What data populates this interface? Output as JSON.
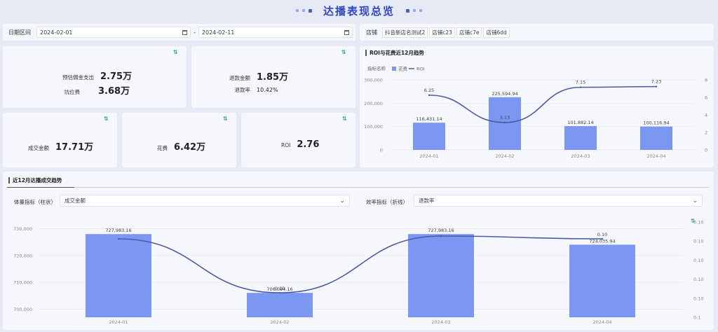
{
  "header": {
    "title": "达播表现总览"
  },
  "filters": {
    "date_label": "日期区间",
    "date_start": "2024-02-01",
    "date_sep": "-",
    "date_end": "2024-02-11",
    "store_label": "店铺",
    "stores": [
      "抖音新店名测试2",
      "店铺c23",
      "店铺c7e",
      "店铺6dd"
    ]
  },
  "kpi_icon": "⇅",
  "kpis": {
    "commission_label": "预估佣金支出",
    "commission_value": "2.75万",
    "slot_fee_label": "坑位费",
    "slot_fee_value": "3.68万",
    "refund_amount_label": "退款金额",
    "refund_amount_value": "1.85万",
    "refund_rate_label": "退款率",
    "refund_rate_value": "10.42%",
    "gmv_label": "成交金额",
    "gmv_value": "17.71万",
    "cost_label": "花费",
    "cost_value": "6.42万",
    "roi_label": "ROI",
    "roi_value": "2.76"
  },
  "roi_chart": {
    "title": "ROI与花费近12月趋势",
    "legend_prefix": "指标名称",
    "chart_data": {
      "type": "bar",
      "categories": [
        "2024-01",
        "2024-02",
        "2024-03",
        "2024-04"
      ],
      "series": [
        {
          "name": "花费",
          "type": "bar",
          "axis": "left",
          "values": [
            116431.14,
            225594.94,
            101882.14,
            100116.94
          ],
          "labels": [
            "116,431.14",
            "225,594.94",
            "101,882.14",
            "100,116.94"
          ]
        },
        {
          "name": "ROI",
          "type": "line",
          "axis": "right",
          "values": [
            6.25,
            3.13,
            7.15,
            7.23
          ],
          "labels": [
            "6.25",
            "3.13",
            "7.15",
            "7.23"
          ]
        }
      ],
      "left_ticks": [
        "0",
        "100,000",
        "200,000",
        "300,000"
      ],
      "ylim_left": [
        0,
        300000
      ],
      "right_ticks": [
        "0",
        "2",
        "4",
        "6",
        "8"
      ],
      "ylim_right": [
        0,
        8
      ],
      "colors": {
        "bar": "#7b97f2",
        "line": "#4b5aa3"
      }
    }
  },
  "trend_chart": {
    "tab": "近12月达播成交趋势",
    "volume_label": "体量指标（柱状）",
    "volume_value": "成交金额",
    "efficiency_label": "效率指标（折线）",
    "efficiency_value": "退款率",
    "icon": "⇅",
    "chart_data": {
      "type": "bar",
      "categories": [
        "2024-01",
        "2024-02",
        "2024-03",
        "2024-04"
      ],
      "series": [
        {
          "name": "成交金额",
          "type": "bar",
          "axis": "left",
          "values": [
            727983.16,
            706094.16,
            727983.16,
            724035.94
          ],
          "labels": [
            "727,983.16",
            "706,094.16",
            "727,983.16",
            "724,035.94"
          ]
        },
        {
          "name": "退款率",
          "type": "line",
          "axis": "right",
          "values": [
            0.1,
            0.1,
            0.1,
            0.1
          ],
          "labels": [
            "",
            "0.10",
            "",
            "0.10"
          ]
        }
      ],
      "left_ticks": [
        "700,000",
        "710,000",
        "720,000",
        "730,000"
      ],
      "ylim_left": [
        697000,
        733000
      ],
      "right_ticks": [
        "0.1",
        "0.10",
        "0.10",
        "0.10",
        "0.10",
        "0.10"
      ],
      "colors": {
        "bar": "#7b97f2",
        "line": "#4b5aa3"
      }
    }
  }
}
